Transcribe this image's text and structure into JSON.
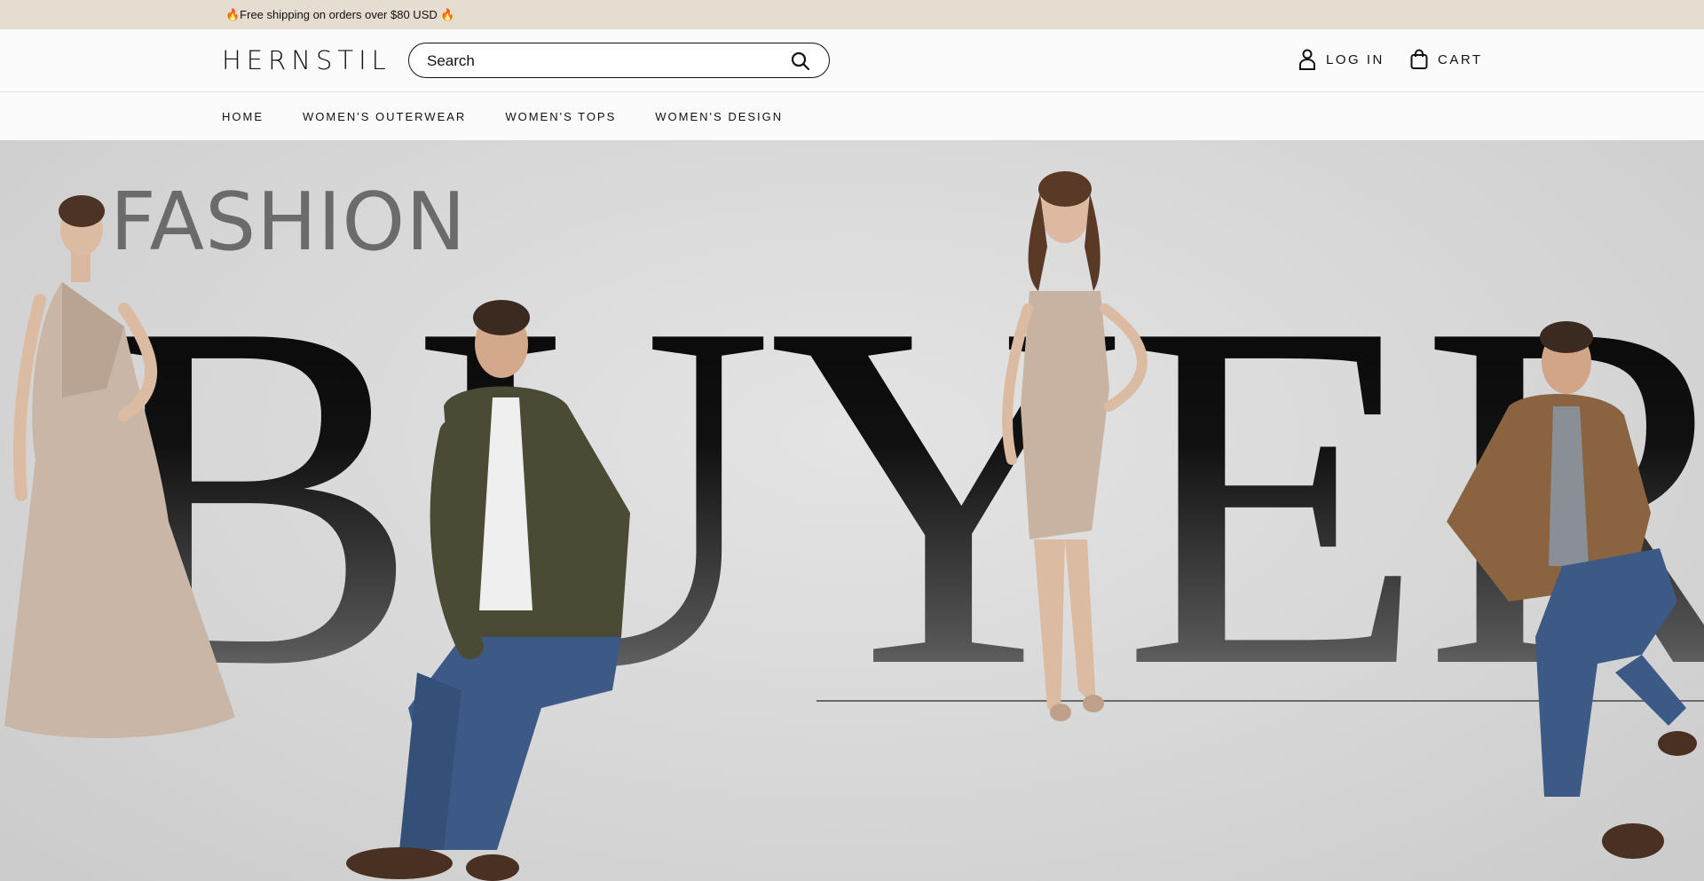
{
  "announcement": {
    "text": "🔥Free shipping on orders over $80 USD 🔥"
  },
  "header": {
    "logo": "HERNSTIL",
    "search": {
      "placeholder": "Search",
      "icon": "search-icon"
    },
    "login": {
      "label": "LOG IN",
      "icon": "user-icon"
    },
    "cart": {
      "label": "CART",
      "icon": "bag-icon"
    }
  },
  "nav": {
    "items": [
      {
        "label": "HOME"
      },
      {
        "label": "WOMEN'S OUTERWEAR"
      },
      {
        "label": "WOMEN'S TOPS"
      },
      {
        "label": "WOMEN'S DESIGN"
      }
    ]
  },
  "hero": {
    "small_text": "FASHION",
    "big_text": "BUYER",
    "colors": {
      "background": "#d9d9d9",
      "announcement_bg": "#e6ddd1",
      "dress": "#c9b6a6",
      "jacket_olive": "#4a4a35",
      "jacket_brown": "#8a6440",
      "jeans": "#3d5a86",
      "boots": "#4a3022"
    }
  }
}
